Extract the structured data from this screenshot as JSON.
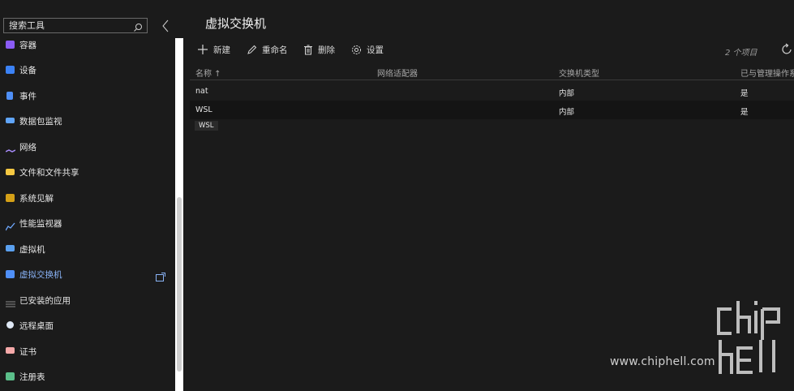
{
  "sidebar": {
    "search_placeholder": "搜索工具",
    "items": [
      {
        "label": "容器",
        "icon": "container-icon",
        "color": "#8b5cf6"
      },
      {
        "label": "设备",
        "icon": "device-icon",
        "color": "#3b82f6"
      },
      {
        "label": "事件",
        "icon": "events-icon",
        "color": "#4f8ff7"
      },
      {
        "label": "数据包监视",
        "icon": "packet-monitor-icon",
        "color": "#60a5fa"
      },
      {
        "label": "网络",
        "icon": "network-icon",
        "color": "#a78bfa"
      },
      {
        "label": "文件和文件共享",
        "icon": "folder-icon",
        "color": "#f5c842"
      },
      {
        "label": "系统见解",
        "icon": "system-insights-icon",
        "color": "#d4a017"
      },
      {
        "label": "性能监视器",
        "icon": "performance-monitor-icon",
        "color": "#6ea8fe"
      },
      {
        "label": "虚拟机",
        "icon": "virtual-machine-icon",
        "color": "#5aa0ef"
      },
      {
        "label": "虚拟交换机",
        "icon": "virtual-switch-icon",
        "color": "#4f8ff7",
        "active": true
      },
      {
        "label": "已安装的应用",
        "icon": "installed-apps-icon",
        "color": "#8a8a8a"
      },
      {
        "label": "远程桌面",
        "icon": "remote-desktop-icon",
        "color": "#dfe8f5"
      },
      {
        "label": "证书",
        "icon": "certificate-icon",
        "color": "#f5a9a9"
      },
      {
        "label": "注册表",
        "icon": "registry-icon",
        "color": "#5bbf8a"
      }
    ]
  },
  "main": {
    "title": "虚拟交换机",
    "toolbar": {
      "new_label": "新建",
      "rename_label": "重命名",
      "delete_label": "删除",
      "settings_label": "设置",
      "item_count": "2 个项目"
    },
    "table": {
      "headers": [
        "名称 ↑",
        "网络适配器",
        "交换机类型",
        "已与管理操作系"
      ],
      "rows": [
        {
          "name": "nat",
          "adapter": "",
          "type": "内部",
          "shared": "是"
        },
        {
          "name": "WSL",
          "adapter": "",
          "type": "内部",
          "shared": "是"
        }
      ]
    },
    "tooltip": "WSL"
  },
  "watermark": {
    "url": "www.chiphell.com",
    "logo": "chiphell-logo"
  },
  "colors": {
    "background": "#1b1b1b",
    "accent": "#8ab4f8"
  }
}
